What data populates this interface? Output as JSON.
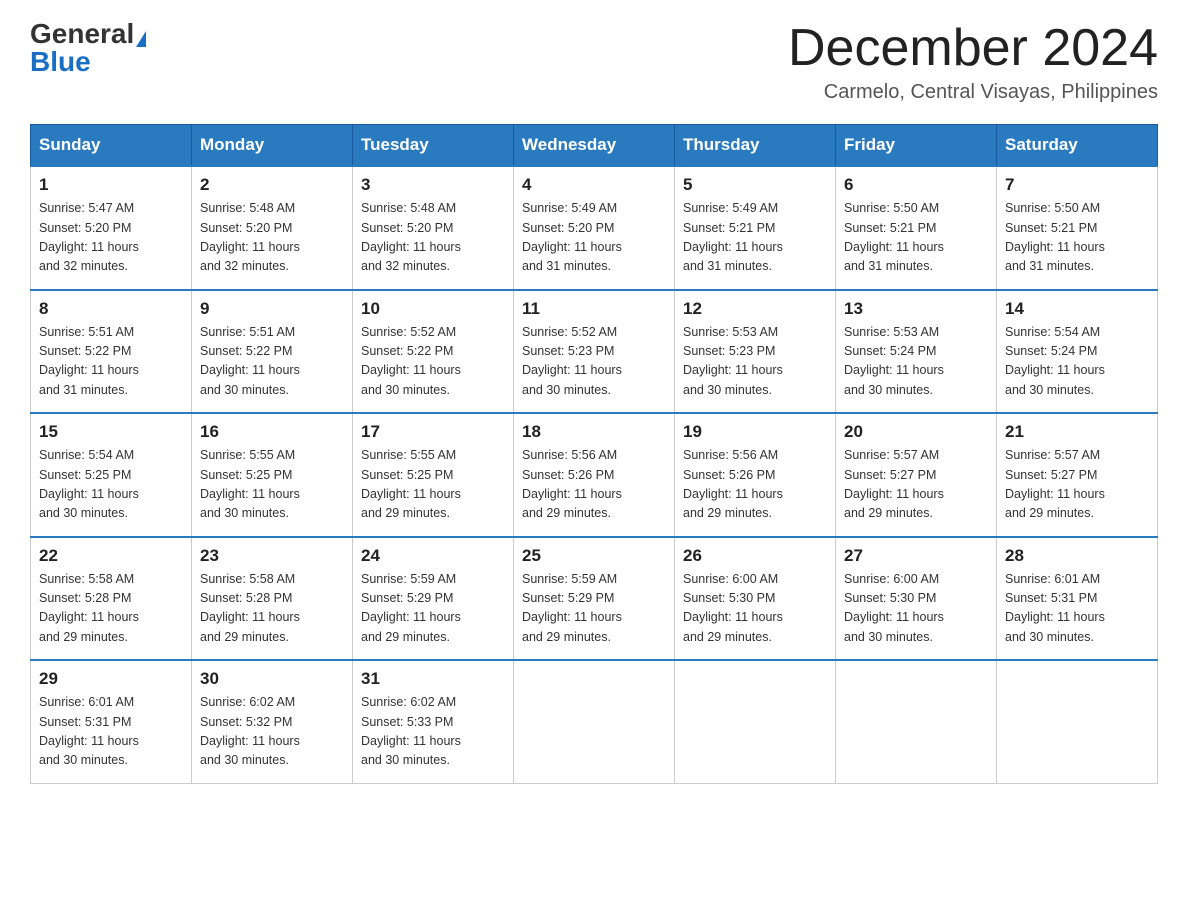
{
  "header": {
    "logo_general": "General",
    "logo_blue": "Blue",
    "title": "December 2024",
    "subtitle": "Carmelo, Central Visayas, Philippines"
  },
  "days_of_week": [
    "Sunday",
    "Monday",
    "Tuesday",
    "Wednesday",
    "Thursday",
    "Friday",
    "Saturday"
  ],
  "weeks": [
    [
      {
        "day": "1",
        "sunrise": "5:47 AM",
        "sunset": "5:20 PM",
        "daylight": "11 hours and 32 minutes."
      },
      {
        "day": "2",
        "sunrise": "5:48 AM",
        "sunset": "5:20 PM",
        "daylight": "11 hours and 32 minutes."
      },
      {
        "day": "3",
        "sunrise": "5:48 AM",
        "sunset": "5:20 PM",
        "daylight": "11 hours and 32 minutes."
      },
      {
        "day": "4",
        "sunrise": "5:49 AM",
        "sunset": "5:20 PM",
        "daylight": "11 hours and 31 minutes."
      },
      {
        "day": "5",
        "sunrise": "5:49 AM",
        "sunset": "5:21 PM",
        "daylight": "11 hours and 31 minutes."
      },
      {
        "day": "6",
        "sunrise": "5:50 AM",
        "sunset": "5:21 PM",
        "daylight": "11 hours and 31 minutes."
      },
      {
        "day": "7",
        "sunrise": "5:50 AM",
        "sunset": "5:21 PM",
        "daylight": "11 hours and 31 minutes."
      }
    ],
    [
      {
        "day": "8",
        "sunrise": "5:51 AM",
        "sunset": "5:22 PM",
        "daylight": "11 hours and 31 minutes."
      },
      {
        "day": "9",
        "sunrise": "5:51 AM",
        "sunset": "5:22 PM",
        "daylight": "11 hours and 30 minutes."
      },
      {
        "day": "10",
        "sunrise": "5:52 AM",
        "sunset": "5:22 PM",
        "daylight": "11 hours and 30 minutes."
      },
      {
        "day": "11",
        "sunrise": "5:52 AM",
        "sunset": "5:23 PM",
        "daylight": "11 hours and 30 minutes."
      },
      {
        "day": "12",
        "sunrise": "5:53 AM",
        "sunset": "5:23 PM",
        "daylight": "11 hours and 30 minutes."
      },
      {
        "day": "13",
        "sunrise": "5:53 AM",
        "sunset": "5:24 PM",
        "daylight": "11 hours and 30 minutes."
      },
      {
        "day": "14",
        "sunrise": "5:54 AM",
        "sunset": "5:24 PM",
        "daylight": "11 hours and 30 minutes."
      }
    ],
    [
      {
        "day": "15",
        "sunrise": "5:54 AM",
        "sunset": "5:25 PM",
        "daylight": "11 hours and 30 minutes."
      },
      {
        "day": "16",
        "sunrise": "5:55 AM",
        "sunset": "5:25 PM",
        "daylight": "11 hours and 30 minutes."
      },
      {
        "day": "17",
        "sunrise": "5:55 AM",
        "sunset": "5:25 PM",
        "daylight": "11 hours and 29 minutes."
      },
      {
        "day": "18",
        "sunrise": "5:56 AM",
        "sunset": "5:26 PM",
        "daylight": "11 hours and 29 minutes."
      },
      {
        "day": "19",
        "sunrise": "5:56 AM",
        "sunset": "5:26 PM",
        "daylight": "11 hours and 29 minutes."
      },
      {
        "day": "20",
        "sunrise": "5:57 AM",
        "sunset": "5:27 PM",
        "daylight": "11 hours and 29 minutes."
      },
      {
        "day": "21",
        "sunrise": "5:57 AM",
        "sunset": "5:27 PM",
        "daylight": "11 hours and 29 minutes."
      }
    ],
    [
      {
        "day": "22",
        "sunrise": "5:58 AM",
        "sunset": "5:28 PM",
        "daylight": "11 hours and 29 minutes."
      },
      {
        "day": "23",
        "sunrise": "5:58 AM",
        "sunset": "5:28 PM",
        "daylight": "11 hours and 29 minutes."
      },
      {
        "day": "24",
        "sunrise": "5:59 AM",
        "sunset": "5:29 PM",
        "daylight": "11 hours and 29 minutes."
      },
      {
        "day": "25",
        "sunrise": "5:59 AM",
        "sunset": "5:29 PM",
        "daylight": "11 hours and 29 minutes."
      },
      {
        "day": "26",
        "sunrise": "6:00 AM",
        "sunset": "5:30 PM",
        "daylight": "11 hours and 29 minutes."
      },
      {
        "day": "27",
        "sunrise": "6:00 AM",
        "sunset": "5:30 PM",
        "daylight": "11 hours and 30 minutes."
      },
      {
        "day": "28",
        "sunrise": "6:01 AM",
        "sunset": "5:31 PM",
        "daylight": "11 hours and 30 minutes."
      }
    ],
    [
      {
        "day": "29",
        "sunrise": "6:01 AM",
        "sunset": "5:31 PM",
        "daylight": "11 hours and 30 minutes."
      },
      {
        "day": "30",
        "sunrise": "6:02 AM",
        "sunset": "5:32 PM",
        "daylight": "11 hours and 30 minutes."
      },
      {
        "day": "31",
        "sunrise": "6:02 AM",
        "sunset": "5:33 PM",
        "daylight": "11 hours and 30 minutes."
      },
      null,
      null,
      null,
      null
    ]
  ],
  "labels": {
    "sunrise": "Sunrise:",
    "sunset": "Sunset:",
    "daylight": "Daylight:"
  }
}
